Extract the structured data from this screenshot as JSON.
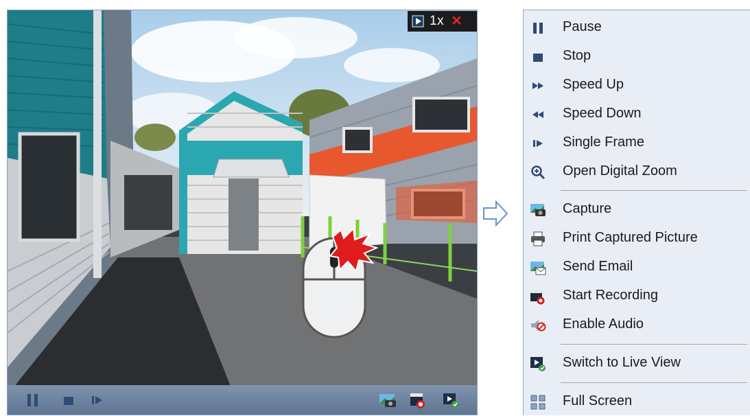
{
  "player": {
    "speed_label": "1x",
    "close_glyph": "✕",
    "overlay_icon": "play-mode-icon",
    "toolbar_left": [
      "pause-icon",
      "stop-icon",
      "single-frame-icon"
    ],
    "toolbar_right": [
      "capture-icon",
      "start-recording-icon",
      "switch-to-live-view-icon"
    ]
  },
  "context_menu": {
    "items": [
      {
        "label": "Pause",
        "icon": "pause-icon"
      },
      {
        "label": "Stop",
        "icon": "stop-icon"
      },
      {
        "label": "Speed Up",
        "icon": "speed-up-icon"
      },
      {
        "label": "Speed Down",
        "icon": "speed-down-icon"
      },
      {
        "label": "Single Frame",
        "icon": "single-frame-icon"
      },
      {
        "label": "Open Digital Zoom",
        "icon": "zoom-in-icon"
      },
      {
        "label": "Capture",
        "icon": "capture-icon"
      },
      {
        "label": "Print Captured Picture",
        "icon": "printer-icon"
      },
      {
        "label": "Send Email",
        "icon": "email-icon"
      },
      {
        "label": "Start Recording",
        "icon": "start-recording-icon"
      },
      {
        "label": "Enable Audio",
        "icon": "audio-disabled-icon"
      },
      {
        "label": "Switch to Live View",
        "icon": "switch-to-live-view-icon"
      },
      {
        "label": "Full Screen",
        "icon": "full-screen-icon"
      }
    ]
  },
  "colors": {
    "menu_background": "#e9eef6",
    "toolbar": "#6f849f",
    "accent_teal": "#2aa7b0",
    "close_red": "#e02424"
  }
}
